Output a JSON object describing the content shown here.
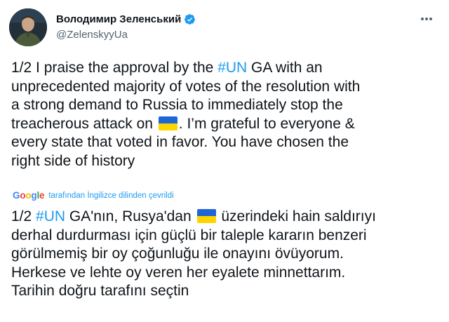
{
  "author": {
    "name": "Володимир Зеленський",
    "handle": "@ZelenskyyUa",
    "avatar_icon": "profile-photo",
    "verified_icon": "verified-badge-icon"
  },
  "tweet": {
    "lines": [
      {
        "before": "1/2 I praise the approval by the ",
        "hashtag": "#UN",
        "after": " GA with an"
      },
      {
        "text": "unprecedented majority of votes of the resolution with"
      },
      {
        "text": "a strong demand to Russia to immediately stop the"
      },
      {
        "before": "treacherous attack on ",
        "flag": "ukraine-flag",
        "after": ". I’m grateful to everyone &"
      },
      {
        "text": "every state that voted in favor. You have chosen the"
      },
      {
        "text": "right side of history"
      }
    ]
  },
  "translation": {
    "provider": "Google",
    "note": "tarafından İngilizce dilinden çevrildi",
    "lines": [
      {
        "before": "1/2 ",
        "hashtag": "#UN",
        "mid": " GA'nın, Rusya'dan ",
        "flag": "ukraine-flag",
        "after": " üzerindeki hain saldırıyı"
      },
      {
        "text": "derhal durdurması için güçlü bir taleple kararın benzeri"
      },
      {
        "text": "görülmemiş bir oy çoğunluğu ile onayını övüyorum."
      },
      {
        "text": "Herkese ve lehte oy veren her eyalete minnettarım."
      },
      {
        "text": "Tarihin doğru tarafını seçtin"
      }
    ]
  },
  "colors": {
    "link": "#1d9bf0",
    "text": "#0f1419",
    "secondary": "#536471",
    "flag_blue": "#1e66d6",
    "flag_yellow": "#ffd500"
  }
}
